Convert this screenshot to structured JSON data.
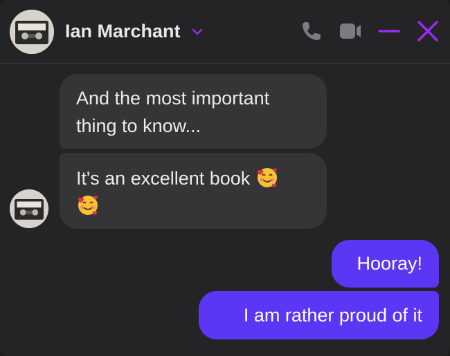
{
  "header": {
    "contact_name": "Ian Marchant",
    "avatar_icon": "cassette-tape-avatar",
    "actions": [
      "phone-icon",
      "video-camera-icon",
      "minimize-icon",
      "close-icon"
    ],
    "accent_color": "#9b2bf0"
  },
  "messages": [
    {
      "sender": "Ian Marchant",
      "direction": "incoming",
      "text": "And the most important thing to know..."
    },
    {
      "sender": "Ian Marchant",
      "direction": "incoming",
      "text": "It's an excellent book",
      "emoji": "smiling-face-with-hearts"
    },
    {
      "direction": "outgoing",
      "text": "Hooray!"
    },
    {
      "direction": "outgoing",
      "text": "I am rather proud of it"
    }
  ],
  "colors": {
    "background": "#242426",
    "incoming_bubble": "#353537",
    "outgoing_bubble": "#5b37f5"
  }
}
